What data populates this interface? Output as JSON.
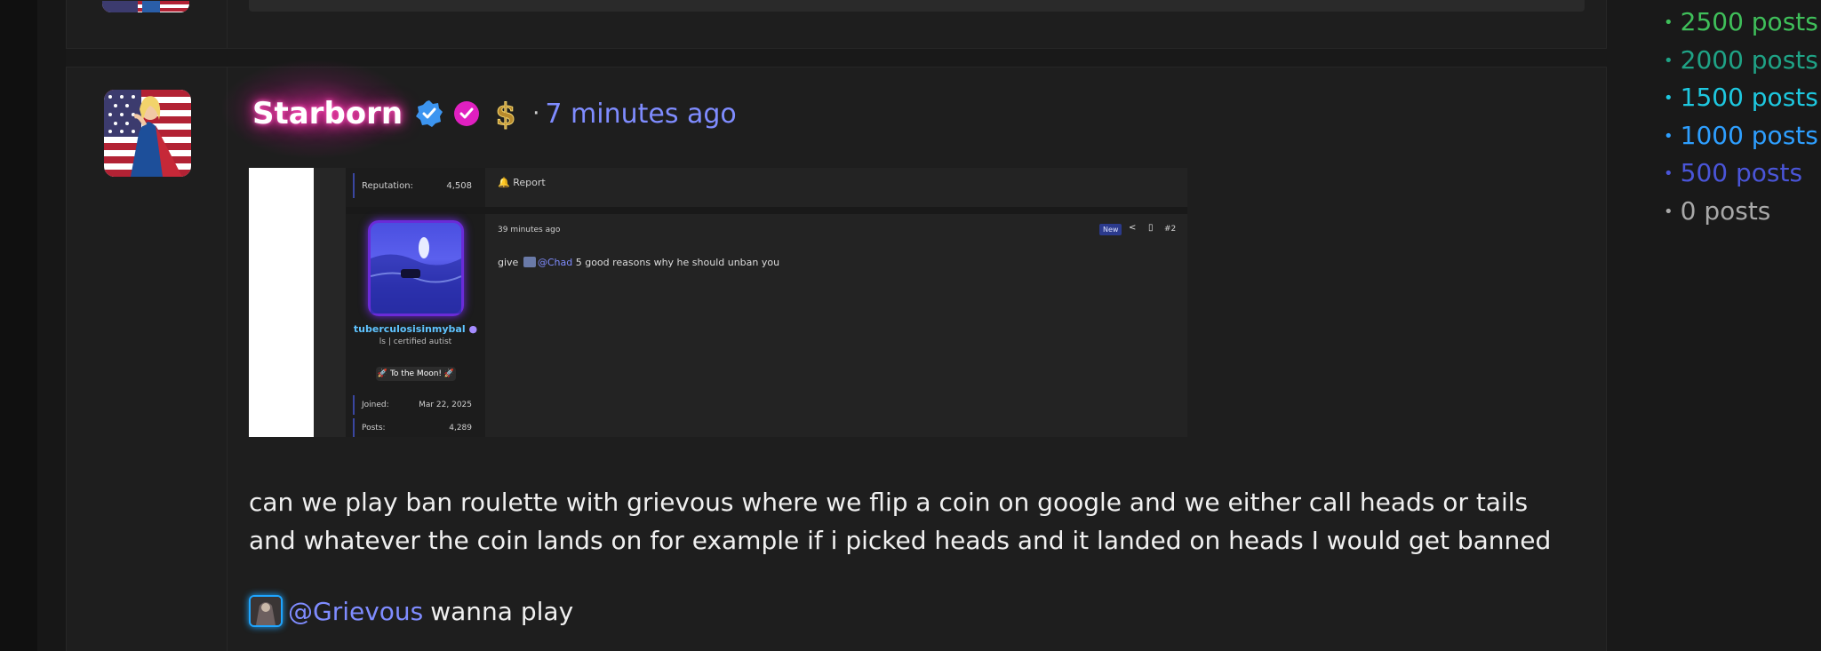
{
  "post": {
    "username": "Starborn",
    "time_ago": "7 minutes ago",
    "separator": "·",
    "message": "can we play ban roulette with grievous where we flip a coin on google and we either call heads or tails and whatever the coin lands on for example if i picked heads and it landed on heads I would get banned",
    "mention": {
      "name": "@Grievous",
      "text": "wanna play"
    },
    "badges": [
      "verified-check-icon",
      "pink-check-icon",
      "dollar-sign-icon"
    ]
  },
  "embedded_screenshot": {
    "reputation_label": "Reputation:",
    "reputation_value": "4,508",
    "report_label": "Report",
    "time": "39 minutes ago",
    "new_badge": "New",
    "post_number": "#2",
    "username": "tuberculosisinmybal",
    "user_title": "ls | certified autist",
    "pill": "🚀 To the Moon! 🚀",
    "joined_label": "Joined:",
    "joined_value": "Mar 22, 2025",
    "posts_label": "Posts:",
    "posts_value": "4,289",
    "body_prefix": "give",
    "body_mention": "@Chad",
    "body_suffix": "5 good reasons why he should unban you"
  },
  "legend": [
    {
      "label": "2500 posts",
      "color": "#3fbf5a"
    },
    {
      "label": "2000 posts",
      "color": "#1fa386"
    },
    {
      "label": "1500 posts",
      "color": "#1ec8e0"
    },
    {
      "label": "1000 posts",
      "color": "#2e9fff"
    },
    {
      "label": "500 posts",
      "color": "#4a55d8"
    },
    {
      "label": "0 posts",
      "color": "#a8a8a8"
    }
  ],
  "colors": {
    "link": "#7f8cff",
    "username_glow": "#ff3fb0",
    "background": "#191919",
    "panel": "#1e1e1e"
  }
}
